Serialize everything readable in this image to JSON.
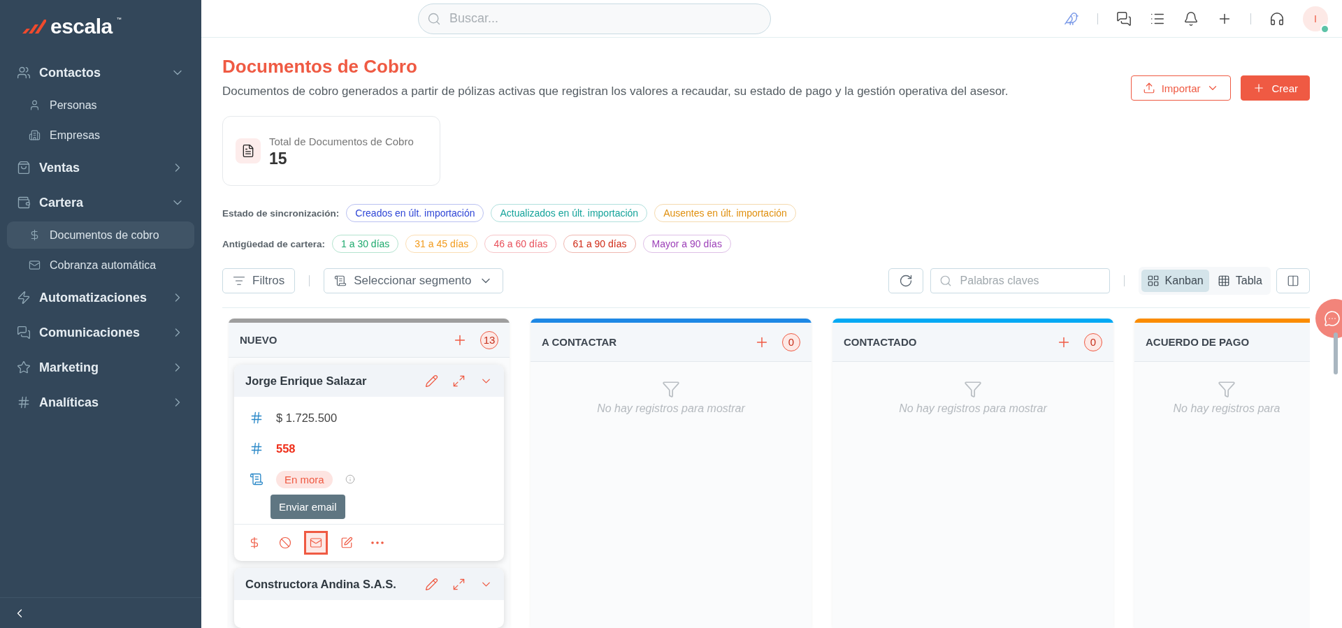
{
  "brand": {
    "name": "escala",
    "mark": "™"
  },
  "sidebar": {
    "items": [
      {
        "label": "Contactos",
        "expanded": true,
        "children": [
          {
            "label": "Personas",
            "selected": false
          },
          {
            "label": "Empresas",
            "selected": false
          }
        ]
      },
      {
        "label": "Ventas",
        "expanded": false
      },
      {
        "label": "Cartera",
        "expanded": true,
        "children": [
          {
            "label": "Documentos de cobro",
            "selected": true
          },
          {
            "label": "Cobranza automática",
            "selected": false
          }
        ]
      },
      {
        "label": "Automatizaciones",
        "expanded": false
      },
      {
        "label": "Comunicaciones",
        "expanded": false
      },
      {
        "label": "Marketing",
        "expanded": false
      },
      {
        "label": "Analíticas",
        "expanded": false
      }
    ]
  },
  "search": {
    "placeholder": "Buscar..."
  },
  "user": {
    "initial": "I",
    "online": true
  },
  "page": {
    "title": "Documentos de Cobro",
    "description": "Documentos de cobro generados a partir de pólizas activas que registran los valores a recaudar, su estado de pago y la gestión operativa del asesor."
  },
  "actions": [
    {
      "label": "Importar",
      "kind": "outline"
    },
    {
      "label": "Crear",
      "kind": "solid"
    }
  ],
  "stat": {
    "label": "Total de Documentos de Cobro",
    "value": "15"
  },
  "filter_groups": [
    {
      "label": "Estado de sincronización:",
      "tags": [
        {
          "label": "Creados en últ. importación",
          "color": "#2f46d6"
        },
        {
          "label": "Actualizados en últ. importación",
          "color": "#14a39a"
        },
        {
          "label": "Ausentes en últ. importación",
          "color": "#e0900f"
        }
      ]
    },
    {
      "label": "Antigüedad de cartera:",
      "tags": [
        {
          "label": "1 a 30 días",
          "color": "#1faa6e"
        },
        {
          "label": "31 a 45 días",
          "color": "#f29b1d"
        },
        {
          "label": "46 a 60 días",
          "color": "#e8505b"
        },
        {
          "label": "61 a 90 días",
          "color": "#d02a16"
        },
        {
          "label": "Mayor a 90 días",
          "color": "#9c3fb8"
        }
      ]
    }
  ],
  "toolbar": {
    "filters": "Filtros",
    "segment": "Seleccionar segmento",
    "keywords_placeholder": "Palabras claves",
    "views": [
      {
        "label": "Kanban",
        "selected": true
      },
      {
        "label": "Tabla",
        "selected": false
      }
    ]
  },
  "columns": [
    {
      "title": "NUEVO",
      "count": "13",
      "color": "#9e9e9e",
      "cards": [
        {
          "name": "Jorge Enrique Salazar",
          "expanded": true,
          "amount": "$ 1.725.500",
          "number": "558",
          "status": "En mora",
          "tooltip": "Enviar email",
          "actions": [
            {
              "hovered": false
            },
            {
              "hovered": false
            },
            {
              "hovered": true
            },
            {
              "hovered": false
            },
            {
              "hovered": false
            }
          ]
        },
        {
          "name": "Constructora Andina S.A.S.",
          "expanded": true
        }
      ]
    },
    {
      "title": "A CONTACTAR",
      "count": "0",
      "color": "#1e88e5",
      "empty": "No hay registros para mostrar"
    },
    {
      "title": "CONTACTADO",
      "count": "0",
      "color": "#03a9f4",
      "empty": "No hay registros para mostrar"
    },
    {
      "title": "ACUERDO DE PAGO",
      "color": "#fb8c00",
      "empty": "No hay registros para"
    }
  ]
}
